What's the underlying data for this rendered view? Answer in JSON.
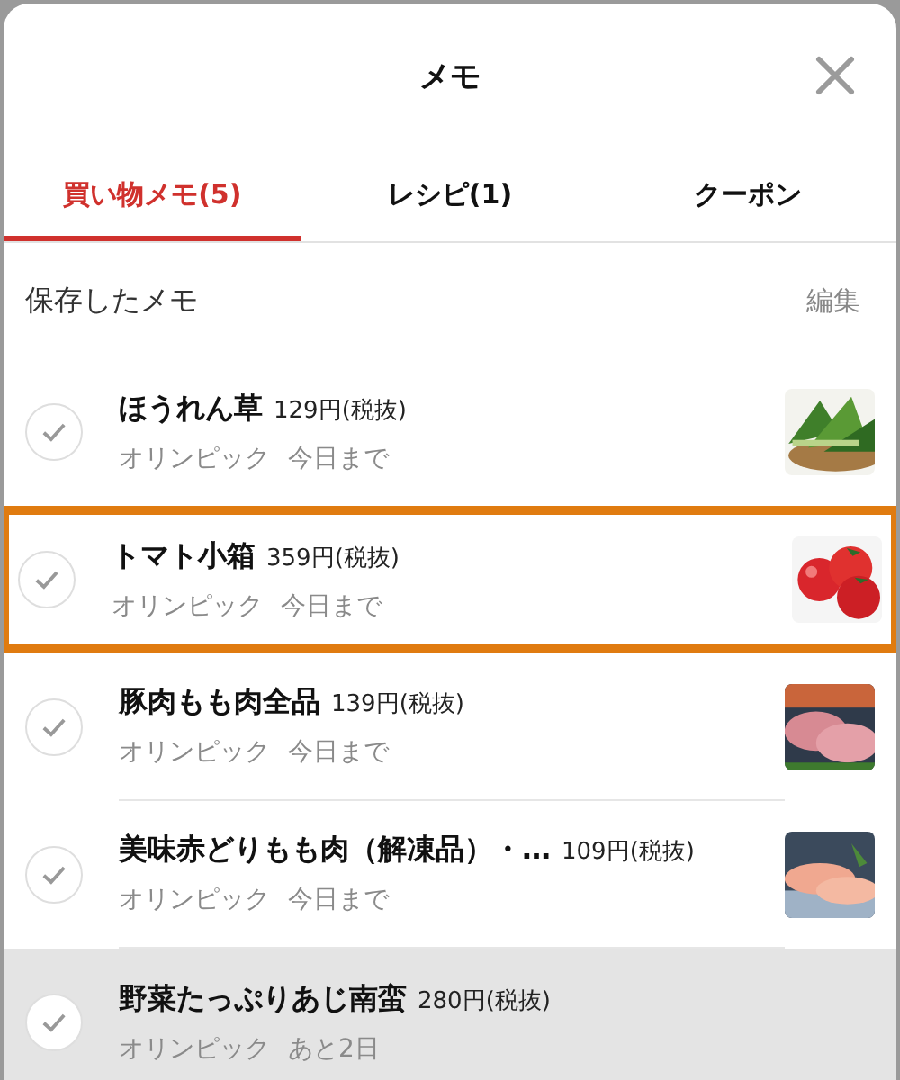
{
  "window": {
    "title": "メモ"
  },
  "tabs": [
    {
      "label": "買い物メモ(5)",
      "selected": true
    },
    {
      "label": "レシピ(1)",
      "selected": false
    },
    {
      "label": "クーポン",
      "selected": false
    }
  ],
  "section": {
    "title": "保存したメモ",
    "action": "編集"
  },
  "items": [
    {
      "name": "ほうれん草",
      "price": "129円(税抜)",
      "store": "オリンピック",
      "deadline": "今日まで",
      "highlighted": false,
      "pressed": false
    },
    {
      "name": "トマト小箱",
      "price": "359円(税抜)",
      "store": "オリンピック",
      "deadline": "今日まで",
      "highlighted": true,
      "pressed": false
    },
    {
      "name": "豚肉もも肉全品",
      "price": "139円(税抜)",
      "store": "オリンピック",
      "deadline": "今日まで",
      "highlighted": false,
      "pressed": false
    },
    {
      "name": "美味赤どりもも肉（解凍品）・…",
      "price": "109円(税抜)",
      "store": "オリンピック",
      "deadline": "今日まで",
      "highlighted": false,
      "pressed": false
    },
    {
      "name": "野菜たっぷりあじ南蛮",
      "price": "280円(税抜)",
      "store": "オリンピック",
      "deadline": "あと2日",
      "highlighted": false,
      "pressed": true
    }
  ]
}
